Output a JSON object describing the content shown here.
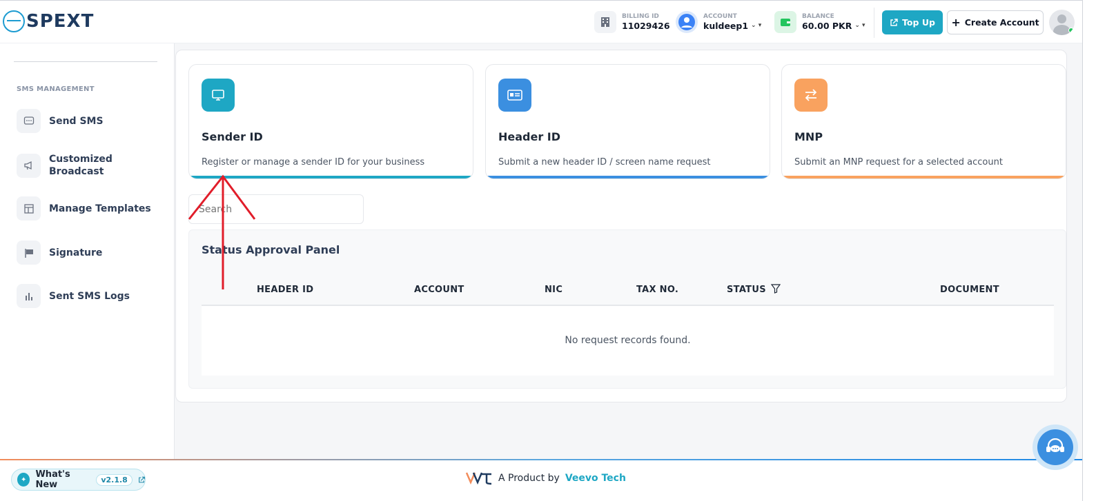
{
  "brand": {
    "name": "SPEXT"
  },
  "header": {
    "billing": {
      "label": "BILLING ID",
      "value": "11029426"
    },
    "account": {
      "label": "ACCOUNT",
      "value": "kuldeep1"
    },
    "balance": {
      "label": "BALANCE",
      "value": "60.00 PKR"
    },
    "topup_label": "Top Up",
    "create_label": "Create Account"
  },
  "sidebar": {
    "section": "SMS MANAGEMENT",
    "items": [
      {
        "label": "Send SMS",
        "icon": "message-icon"
      },
      {
        "label": "Customized Broadcast",
        "icon": "megaphone-icon"
      },
      {
        "label": "Manage Templates",
        "icon": "template-icon"
      },
      {
        "label": "Signature",
        "icon": "flag-icon"
      },
      {
        "label": "Sent SMS Logs",
        "icon": "chart-icon"
      }
    ]
  },
  "cards": [
    {
      "title": "Sender ID",
      "desc": "Register or manage a sender ID for your business",
      "color": "#1ea7c4",
      "icon": "monitor-icon"
    },
    {
      "title": "Header ID",
      "desc": "Submit a new header ID / screen name request",
      "color": "#3b8fe0",
      "icon": "id-card-icon"
    },
    {
      "title": "MNP",
      "desc": "Submit an MNP request for a selected account",
      "color": "#f9a25f",
      "icon": "swap-icon"
    }
  ],
  "search": {
    "placeholder": "Search"
  },
  "status_panel": {
    "title": "Status Approval Panel",
    "columns": [
      "HEADER ID",
      "ACCOUNT",
      "NIC",
      "TAX NO.",
      "STATUS",
      "DOCUMENT"
    ],
    "empty_text": "No request records found."
  },
  "footer": {
    "whats_new": "What's New",
    "version": "v2.1.8",
    "product_prefix": "A Product by",
    "product_brand": "Veevo Tech"
  },
  "colors": {
    "accent": "#1ea7c4",
    "annotation": "#e11d2a"
  }
}
